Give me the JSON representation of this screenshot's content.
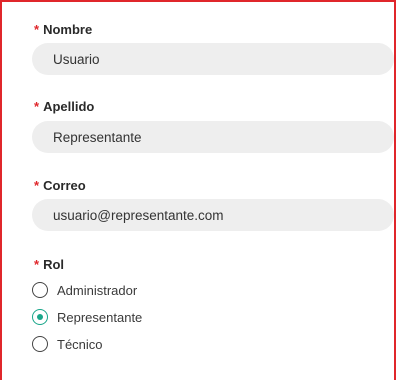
{
  "form": {
    "required_marker": "*",
    "accent_color": "#1aa68a",
    "required_color": "#e0262b",
    "nombre": {
      "label": "Nombre",
      "value": "Usuario"
    },
    "apellido": {
      "label": "Apellido",
      "value": "Representante"
    },
    "correo": {
      "label": "Correo",
      "value": "usuario@representante.com"
    },
    "rol": {
      "label": "Rol",
      "options": [
        {
          "label": "Administrador",
          "checked": false
        },
        {
          "label": "Representante",
          "checked": true
        },
        {
          "label": "Técnico",
          "checked": false
        }
      ]
    }
  }
}
